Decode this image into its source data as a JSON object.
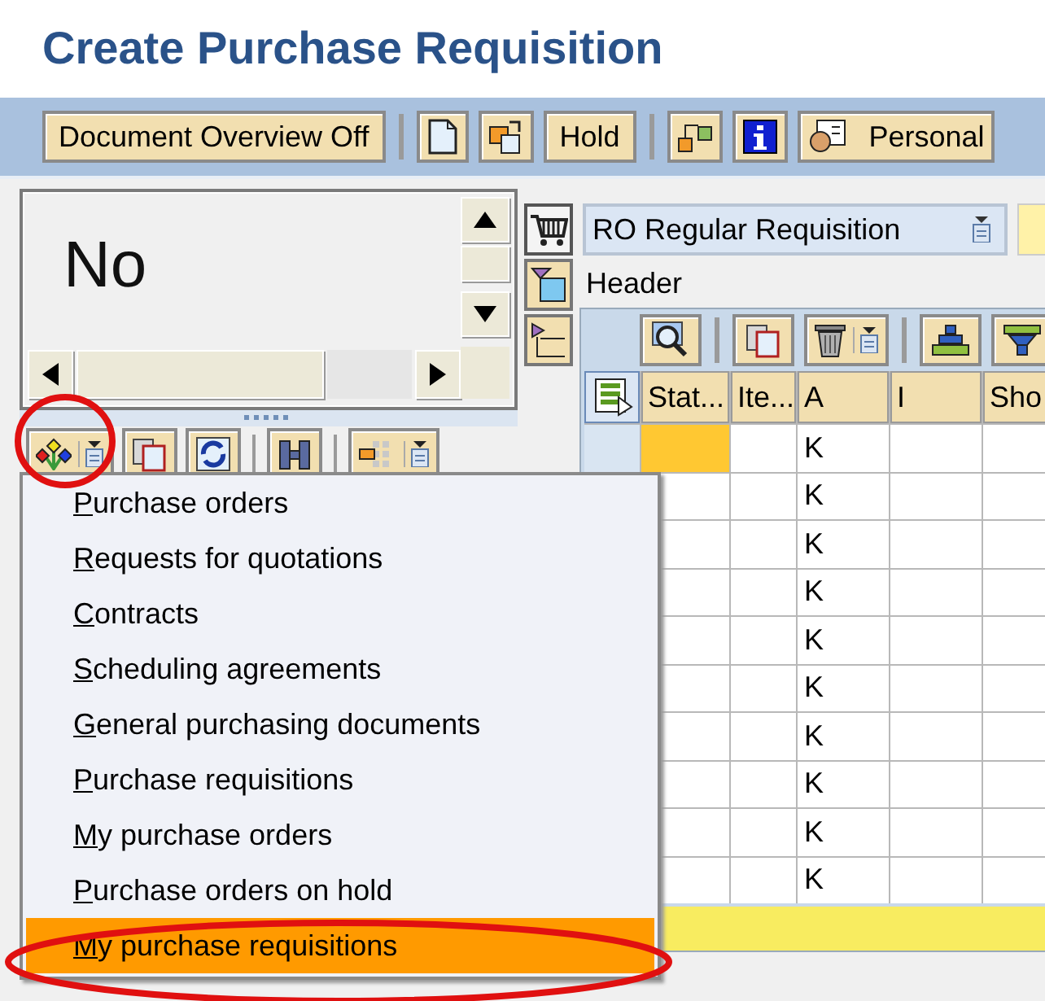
{
  "window": {
    "title": "Create Purchase Requisition"
  },
  "toolbar": [
    [
      {
        "kind": "text",
        "label": "Document Overview Off"
      }
    ],
    [
      {
        "kind": "page"
      },
      {
        "kind": "swap"
      },
      {
        "kind": "text",
        "label": "Hold"
      }
    ],
    [
      {
        "kind": "flow"
      },
      {
        "kind": "info"
      },
      {
        "kind": "personal",
        "label": "Personal"
      }
    ]
  ],
  "overview": {
    "text": "No",
    "toolbar": [
      [
        {
          "kind": "tree",
          "dropdown": true,
          "circled": true
        },
        {
          "kind": "copy",
          "dropdown": false,
          "circled": false
        },
        {
          "kind": "refresh",
          "dropdown": false,
          "circled": false
        }
      ],
      [
        {
          "kind": "find",
          "dropdown": false,
          "circled": false
        }
      ],
      [
        {
          "kind": "layout",
          "dropdown": true,
          "circled": false
        }
      ]
    ]
  },
  "menu": {
    "items": [
      {
        "label": "Purchase orders",
        "selected": false,
        "circled": false
      },
      {
        "label": "Requests for quotations",
        "selected": false,
        "circled": false
      },
      {
        "label": "Contracts",
        "selected": false,
        "circled": false
      },
      {
        "label": "Scheduling agreements",
        "selected": false,
        "circled": false
      },
      {
        "label": "General purchasing documents",
        "selected": false,
        "circled": false
      },
      {
        "label": "Purchase requisitions",
        "selected": false,
        "circled": false
      },
      {
        "label": "My purchase orders",
        "selected": false,
        "circled": false
      },
      {
        "label": "Purchase orders on hold",
        "selected": false,
        "circled": false
      },
      {
        "label": "My purchase requisitions",
        "selected": true,
        "circled": true
      }
    ]
  },
  "document_type": "RO Regular Requisition",
  "side_buttons": [
    {
      "kind": "expand"
    },
    {
      "kind": "collapse"
    }
  ],
  "header": "Header",
  "grid": {
    "toolbar": [
      [
        {
          "kind": "detail",
          "dropdown": false
        }
      ],
      [
        {
          "kind": "copy",
          "dropdown": false
        },
        {
          "kind": "delete",
          "dropdown": true
        }
      ],
      [
        {
          "kind": "sortup",
          "dropdown": false
        },
        {
          "kind": "filter",
          "dropdown": false
        }
      ]
    ],
    "columns": [
      "Stat...",
      "Ite...",
      "A",
      "I",
      "Sho"
    ],
    "rows": [
      {
        "current": true,
        "A": "K"
      },
      {
        "current": false,
        "A": "K"
      },
      {
        "current": false,
        "A": "K"
      },
      {
        "current": false,
        "A": "K"
      },
      {
        "current": false,
        "A": "K"
      },
      {
        "current": false,
        "A": "K"
      },
      {
        "current": false,
        "A": "K"
      },
      {
        "current": false,
        "A": "K"
      },
      {
        "current": false,
        "A": "K"
      },
      {
        "current": false,
        "A": "K"
      }
    ]
  }
}
